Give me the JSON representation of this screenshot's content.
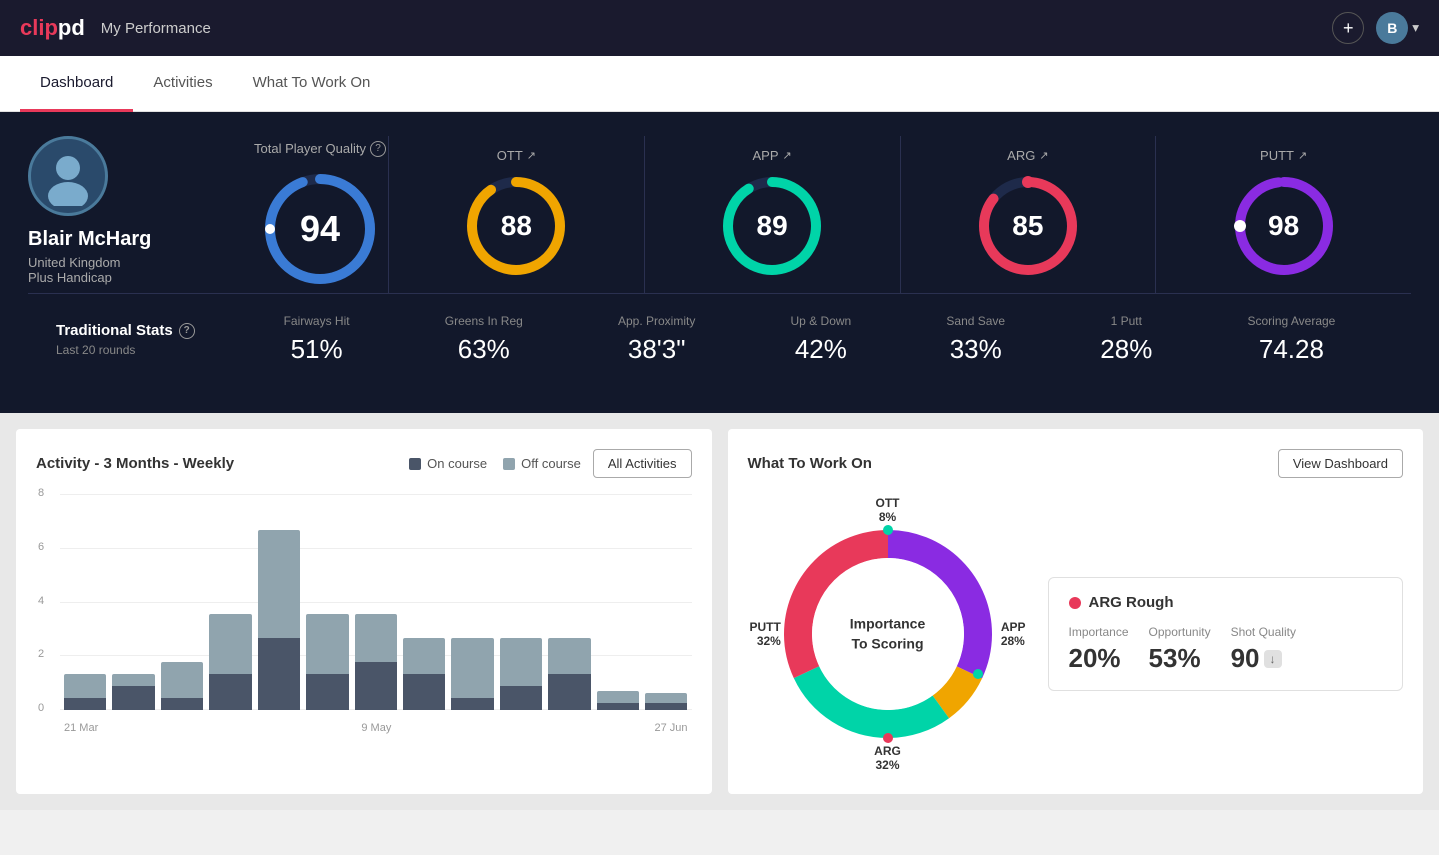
{
  "header": {
    "logo": "clippd",
    "page_title": "My Performance",
    "add_icon": "+",
    "avatar_initial": "B",
    "dropdown_icon": "▾"
  },
  "tabs": [
    {
      "id": "dashboard",
      "label": "Dashboard",
      "active": true
    },
    {
      "id": "activities",
      "label": "Activities",
      "active": false
    },
    {
      "id": "what-to-work-on",
      "label": "What To Work On",
      "active": false
    }
  ],
  "player": {
    "name": "Blair McHarg",
    "country": "United Kingdom",
    "handicap": "Plus Handicap"
  },
  "total_quality": {
    "label": "Total Player Quality",
    "value": 94,
    "color": "#3a7bd5"
  },
  "scores": [
    {
      "id": "ott",
      "label": "OTT",
      "value": 88,
      "color": "#f0a500",
      "trend": "↗"
    },
    {
      "id": "app",
      "label": "APP",
      "value": 89,
      "color": "#00d4a8",
      "trend": "↗"
    },
    {
      "id": "arg",
      "label": "ARG",
      "value": 85,
      "color": "#e8395a",
      "trend": "↗"
    },
    {
      "id": "putt",
      "label": "PUTT",
      "value": 98,
      "color": "#8a2be2",
      "trend": "↗"
    }
  ],
  "trad_stats": {
    "title": "Traditional Stats",
    "subtitle": "Last 20 rounds",
    "stats": [
      {
        "label": "Fairways Hit",
        "value": "51%"
      },
      {
        "label": "Greens In Reg",
        "value": "63%"
      },
      {
        "label": "App. Proximity",
        "value": "38'3\""
      },
      {
        "label": "Up & Down",
        "value": "42%"
      },
      {
        "label": "Sand Save",
        "value": "33%"
      },
      {
        "label": "1 Putt",
        "value": "28%"
      },
      {
        "label": "Scoring Average",
        "value": "74.28"
      }
    ]
  },
  "activity_chart": {
    "title": "Activity - 3 Months - Weekly",
    "legend": {
      "on_course": "On course",
      "off_course": "Off course"
    },
    "all_activities_btn": "All Activities",
    "y_labels": [
      "8",
      "6",
      "4",
      "2",
      "0"
    ],
    "x_labels": [
      "21 Mar",
      "9 May",
      "27 Jun"
    ],
    "bars": [
      {
        "on": 0.5,
        "off": 1.0
      },
      {
        "on": 1.0,
        "off": 0.5
      },
      {
        "on": 0.5,
        "off": 1.5
      },
      {
        "on": 1.5,
        "off": 2.5
      },
      {
        "on": 3.0,
        "off": 4.5
      },
      {
        "on": 1.5,
        "off": 2.5
      },
      {
        "on": 2.0,
        "off": 2.0
      },
      {
        "on": 1.5,
        "off": 1.5
      },
      {
        "on": 0.5,
        "off": 2.5
      },
      {
        "on": 1.0,
        "off": 2.0
      },
      {
        "on": 1.5,
        "off": 1.5
      },
      {
        "on": 0.3,
        "off": 0.5
      },
      {
        "on": 0.3,
        "off": 0.4
      }
    ],
    "colors": {
      "on_course": "#4a5568",
      "off_course": "#90a4ae"
    }
  },
  "what_to_work_on": {
    "title": "What To Work On",
    "view_dashboard_btn": "View Dashboard",
    "donut_center": "Importance\nTo Scoring",
    "segments": [
      {
        "label": "OTT",
        "value": "8%",
        "color": "#f0a500",
        "position": "top"
      },
      {
        "label": "APP",
        "value": "28%",
        "color": "#00d4a8",
        "position": "right"
      },
      {
        "label": "ARG",
        "value": "32%",
        "color": "#e8395a",
        "position": "bottom"
      },
      {
        "label": "PUTT",
        "value": "32%",
        "color": "#8a2be2",
        "position": "left"
      }
    ],
    "info_card": {
      "dot_color": "#e8395a",
      "title": "ARG Rough",
      "metrics": [
        {
          "label": "Importance",
          "value": "20%"
        },
        {
          "label": "Opportunity",
          "value": "53%"
        },
        {
          "label": "Shot Quality",
          "value": "90",
          "badge": "↓"
        }
      ]
    }
  }
}
